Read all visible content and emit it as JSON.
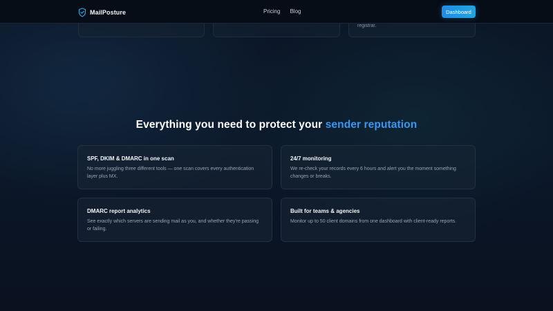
{
  "nav": {
    "brand": "MailPosture",
    "links": [
      "Pricing",
      "Blog"
    ],
    "cta": "Dashboard"
  },
  "top_cards": {
    "third_text": "registrar."
  },
  "section": {
    "title_main": "Everything you need to protect your ",
    "title_accent": "sender reputation"
  },
  "features": [
    {
      "title": "SPF, DKIM & DMARC in one scan",
      "desc": "No more juggling three different tools — one scan covers every authentication layer plus MX."
    },
    {
      "title": "24/7 monitoring",
      "desc": "We re-check your records every 6 hours and alert you the moment something changes or breaks."
    },
    {
      "title": "DMARC report analytics",
      "desc": "See exactly which servers are sending mail as you, and whether they're passing or failing."
    },
    {
      "title": "Built for teams & agencies",
      "desc": "Monitor up to 50 client domains from one dashboard with client-ready reports."
    }
  ],
  "colors": {
    "accent": "#3a96f0",
    "cta": "#1f8de6",
    "background": "#0b1626"
  },
  "icons": {
    "brand": "shield-check-icon"
  }
}
